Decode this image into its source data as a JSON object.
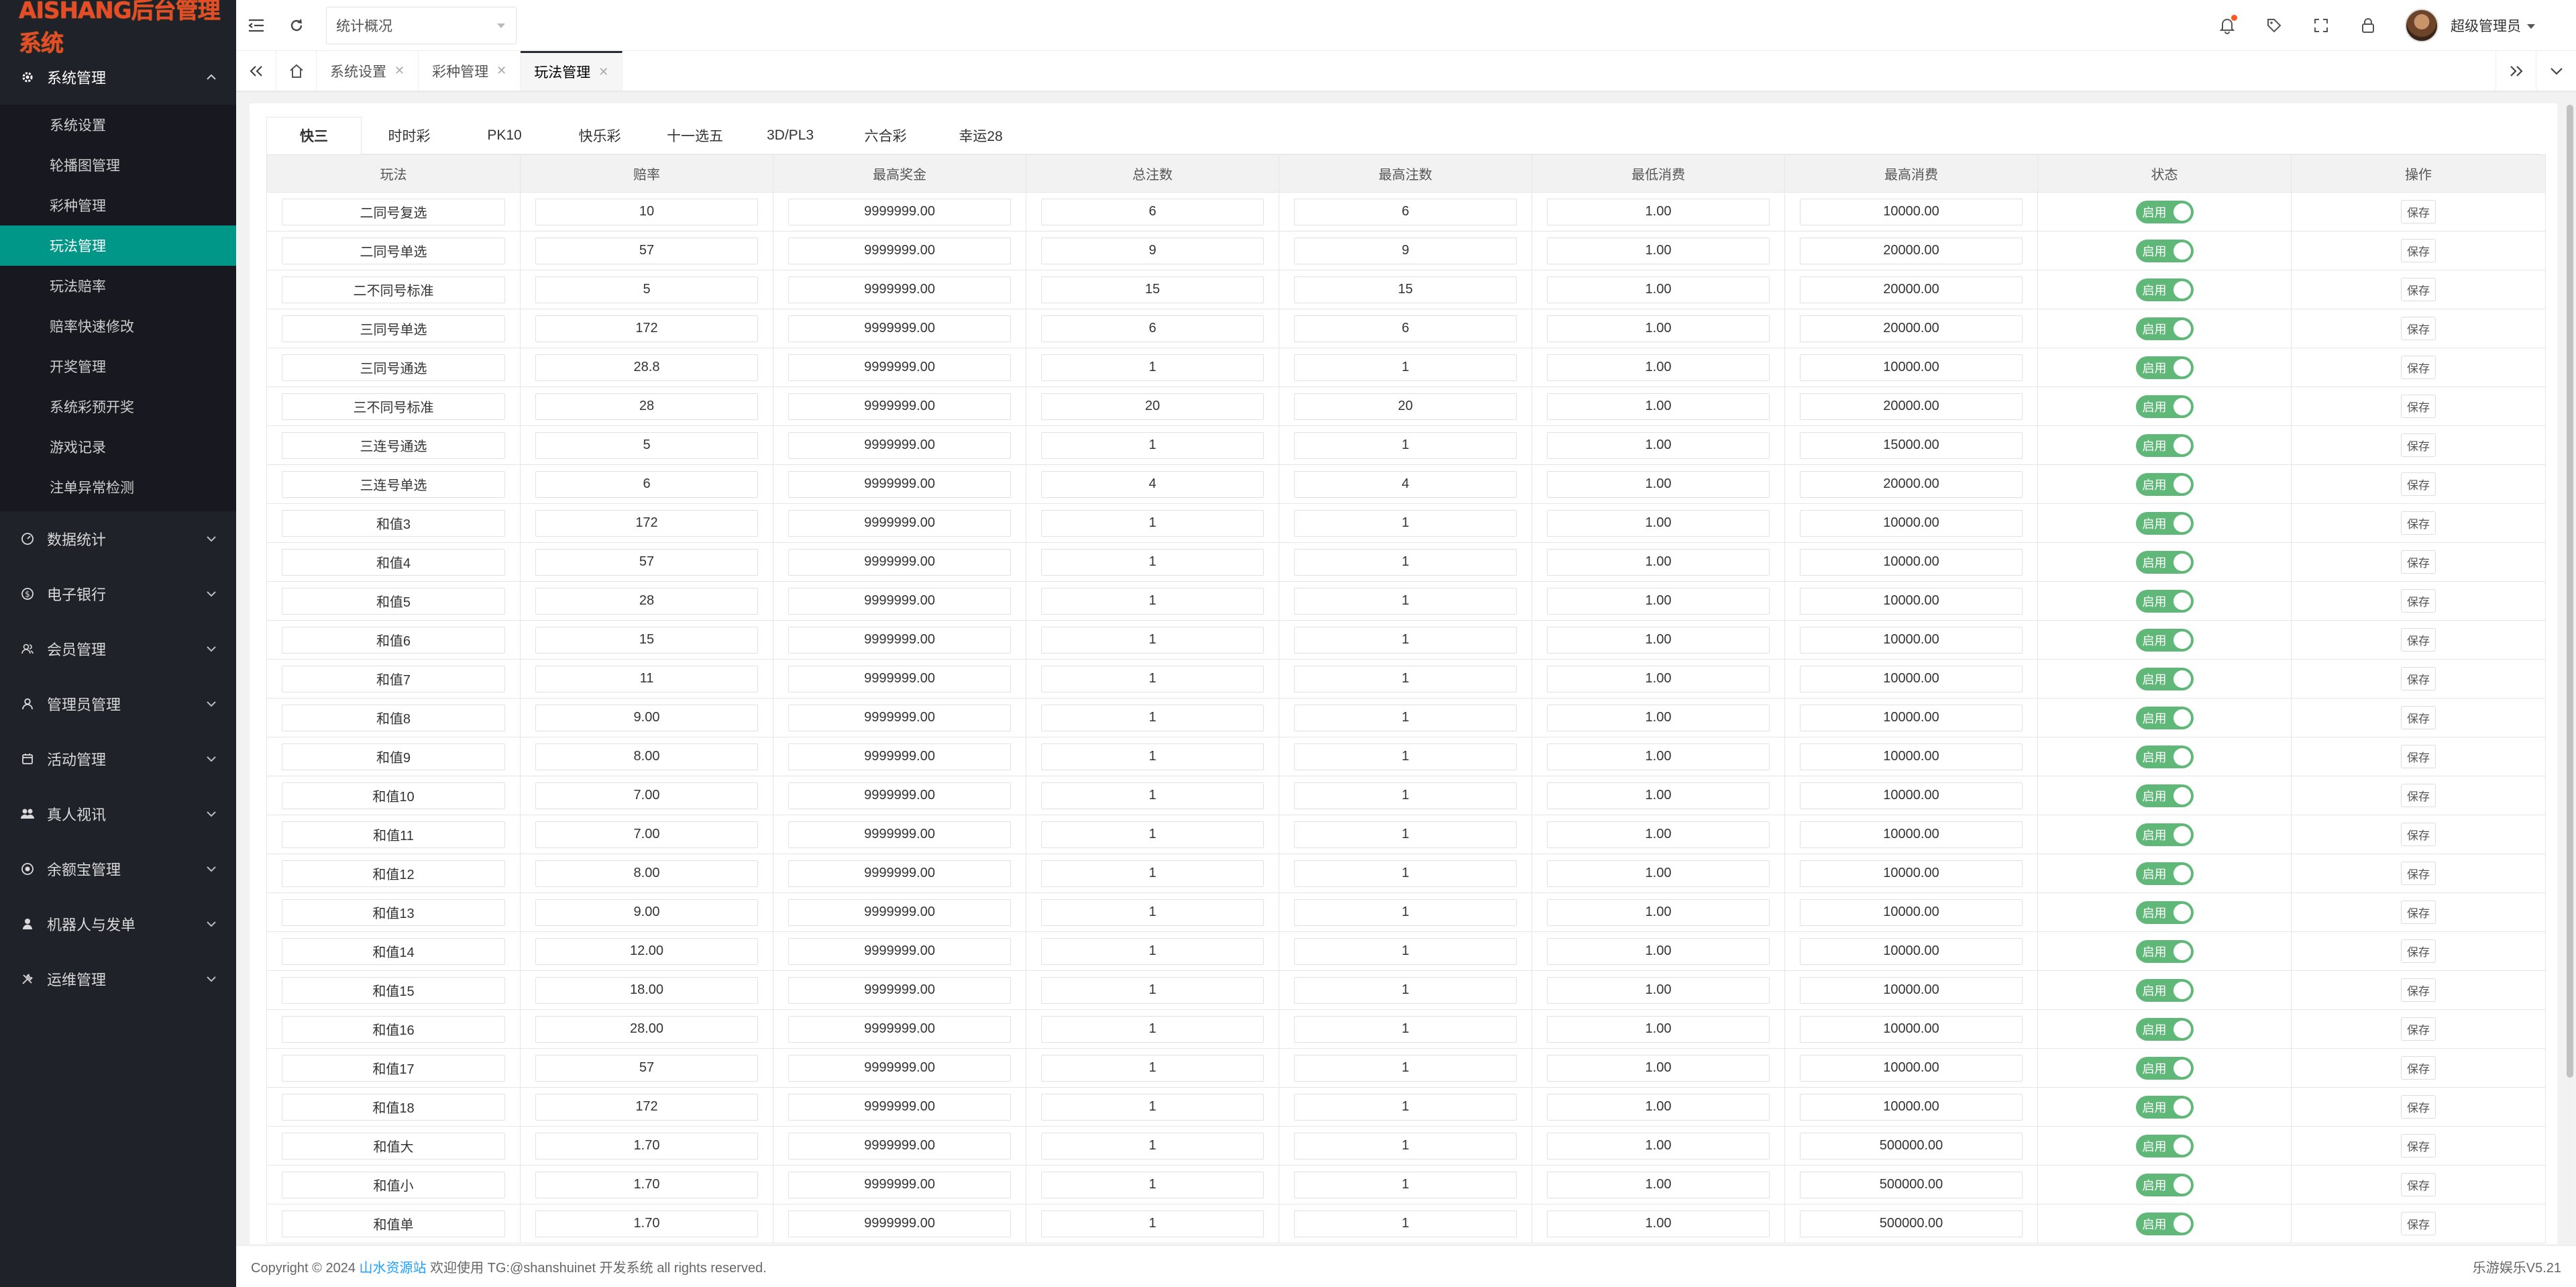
{
  "app": {
    "logo_text": "AISHANG后台管理系统"
  },
  "sidebar": {
    "groups": [
      {
        "label": "系统管理",
        "icon": "gear-icon",
        "open": true,
        "items": [
          "系统设置",
          "轮播图管理",
          "彩种管理",
          "玩法管理",
          "玩法赔率",
          "赔率快速修改",
          "开奖管理",
          "系统彩预开奖",
          "游戏记录",
          "注单异常检测"
        ],
        "active_item": "玩法管理"
      },
      {
        "label": "数据统计",
        "icon": "dashboard-icon"
      },
      {
        "label": "电子银行",
        "icon": "dollar-icon"
      },
      {
        "label": "会员管理",
        "icon": "user-group-icon"
      },
      {
        "label": "管理员管理",
        "icon": "user-icon"
      },
      {
        "label": "活动管理",
        "icon": "calendar-icon"
      },
      {
        "label": "真人视讯",
        "icon": "users-icon"
      },
      {
        "label": "余额宝管理",
        "icon": "piggy-icon"
      },
      {
        "label": "机器人与发单",
        "icon": "robot-icon"
      },
      {
        "label": "运维管理",
        "icon": "tools-icon"
      }
    ]
  },
  "header": {
    "select_value": "统计概况",
    "user_name": "超级管理员"
  },
  "page_tabs": [
    {
      "label": "系统设置",
      "active": false
    },
    {
      "label": "彩种管理",
      "active": false
    },
    {
      "label": "玩法管理",
      "active": true
    }
  ],
  "game_tabs": [
    "快三",
    "时时彩",
    "PK10",
    "快乐彩",
    "十一选五",
    "3D/PL3",
    "六合彩",
    "幸运28"
  ],
  "active_game_tab": "快三",
  "table": {
    "columns": [
      "玩法",
      "赔率",
      "最高奖金",
      "总注数",
      "最高注数",
      "最低消费",
      "最高消费",
      "状态",
      "操作"
    ],
    "status_label": "启用",
    "action_label": "保存",
    "rows": [
      [
        "二同号复选",
        "10",
        "9999999.00",
        "6",
        "6",
        "1.00",
        "10000.00"
      ],
      [
        "二同号单选",
        "57",
        "9999999.00",
        "9",
        "9",
        "1.00",
        "20000.00"
      ],
      [
        "二不同号标准",
        "5",
        "9999999.00",
        "15",
        "15",
        "1.00",
        "20000.00"
      ],
      [
        "三同号单选",
        "172",
        "9999999.00",
        "6",
        "6",
        "1.00",
        "20000.00"
      ],
      [
        "三同号通选",
        "28.8",
        "9999999.00",
        "1",
        "1",
        "1.00",
        "10000.00"
      ],
      [
        "三不同号标准",
        "28",
        "9999999.00",
        "20",
        "20",
        "1.00",
        "20000.00"
      ],
      [
        "三连号通选",
        "5",
        "9999999.00",
        "1",
        "1",
        "1.00",
        "15000.00"
      ],
      [
        "三连号单选",
        "6",
        "9999999.00",
        "4",
        "4",
        "1.00",
        "20000.00"
      ],
      [
        "和值3",
        "172",
        "9999999.00",
        "1",
        "1",
        "1.00",
        "10000.00"
      ],
      [
        "和值4",
        "57",
        "9999999.00",
        "1",
        "1",
        "1.00",
        "10000.00"
      ],
      [
        "和值5",
        "28",
        "9999999.00",
        "1",
        "1",
        "1.00",
        "10000.00"
      ],
      [
        "和值6",
        "15",
        "9999999.00",
        "1",
        "1",
        "1.00",
        "10000.00"
      ],
      [
        "和值7",
        "11",
        "9999999.00",
        "1",
        "1",
        "1.00",
        "10000.00"
      ],
      [
        "和值8",
        "9.00",
        "9999999.00",
        "1",
        "1",
        "1.00",
        "10000.00"
      ],
      [
        "和值9",
        "8.00",
        "9999999.00",
        "1",
        "1",
        "1.00",
        "10000.00"
      ],
      [
        "和值10",
        "7.00",
        "9999999.00",
        "1",
        "1",
        "1.00",
        "10000.00"
      ],
      [
        "和值11",
        "7.00",
        "9999999.00",
        "1",
        "1",
        "1.00",
        "10000.00"
      ],
      [
        "和值12",
        "8.00",
        "9999999.00",
        "1",
        "1",
        "1.00",
        "10000.00"
      ],
      [
        "和值13",
        "9.00",
        "9999999.00",
        "1",
        "1",
        "1.00",
        "10000.00"
      ],
      [
        "和值14",
        "12.00",
        "9999999.00",
        "1",
        "1",
        "1.00",
        "10000.00"
      ],
      [
        "和值15",
        "18.00",
        "9999999.00",
        "1",
        "1",
        "1.00",
        "10000.00"
      ],
      [
        "和值16",
        "28.00",
        "9999999.00",
        "1",
        "1",
        "1.00",
        "10000.00"
      ],
      [
        "和值17",
        "57",
        "9999999.00",
        "1",
        "1",
        "1.00",
        "10000.00"
      ],
      [
        "和值18",
        "172",
        "9999999.00",
        "1",
        "1",
        "1.00",
        "10000.00"
      ],
      [
        "和值大",
        "1.70",
        "9999999.00",
        "1",
        "1",
        "1.00",
        "500000.00"
      ],
      [
        "和值小",
        "1.70",
        "9999999.00",
        "1",
        "1",
        "1.00",
        "500000.00"
      ],
      [
        "和值单",
        "1.70",
        "9999999.00",
        "1",
        "1",
        "1.00",
        "500000.00"
      ]
    ]
  },
  "footer": {
    "prefix": "Copyright © 2024",
    "link_text": "山水资源站",
    "suffix": "欢迎使用 TG:@shanshuinet 开发系统 all rights reserved.",
    "version": "乐游娱乐V5.21"
  },
  "colors": {
    "sidebar_bg": "#20222a",
    "active_green": "#009688",
    "switch_green": "#5fb878",
    "logo": "#e94a28",
    "link": "#1e9fff"
  }
}
